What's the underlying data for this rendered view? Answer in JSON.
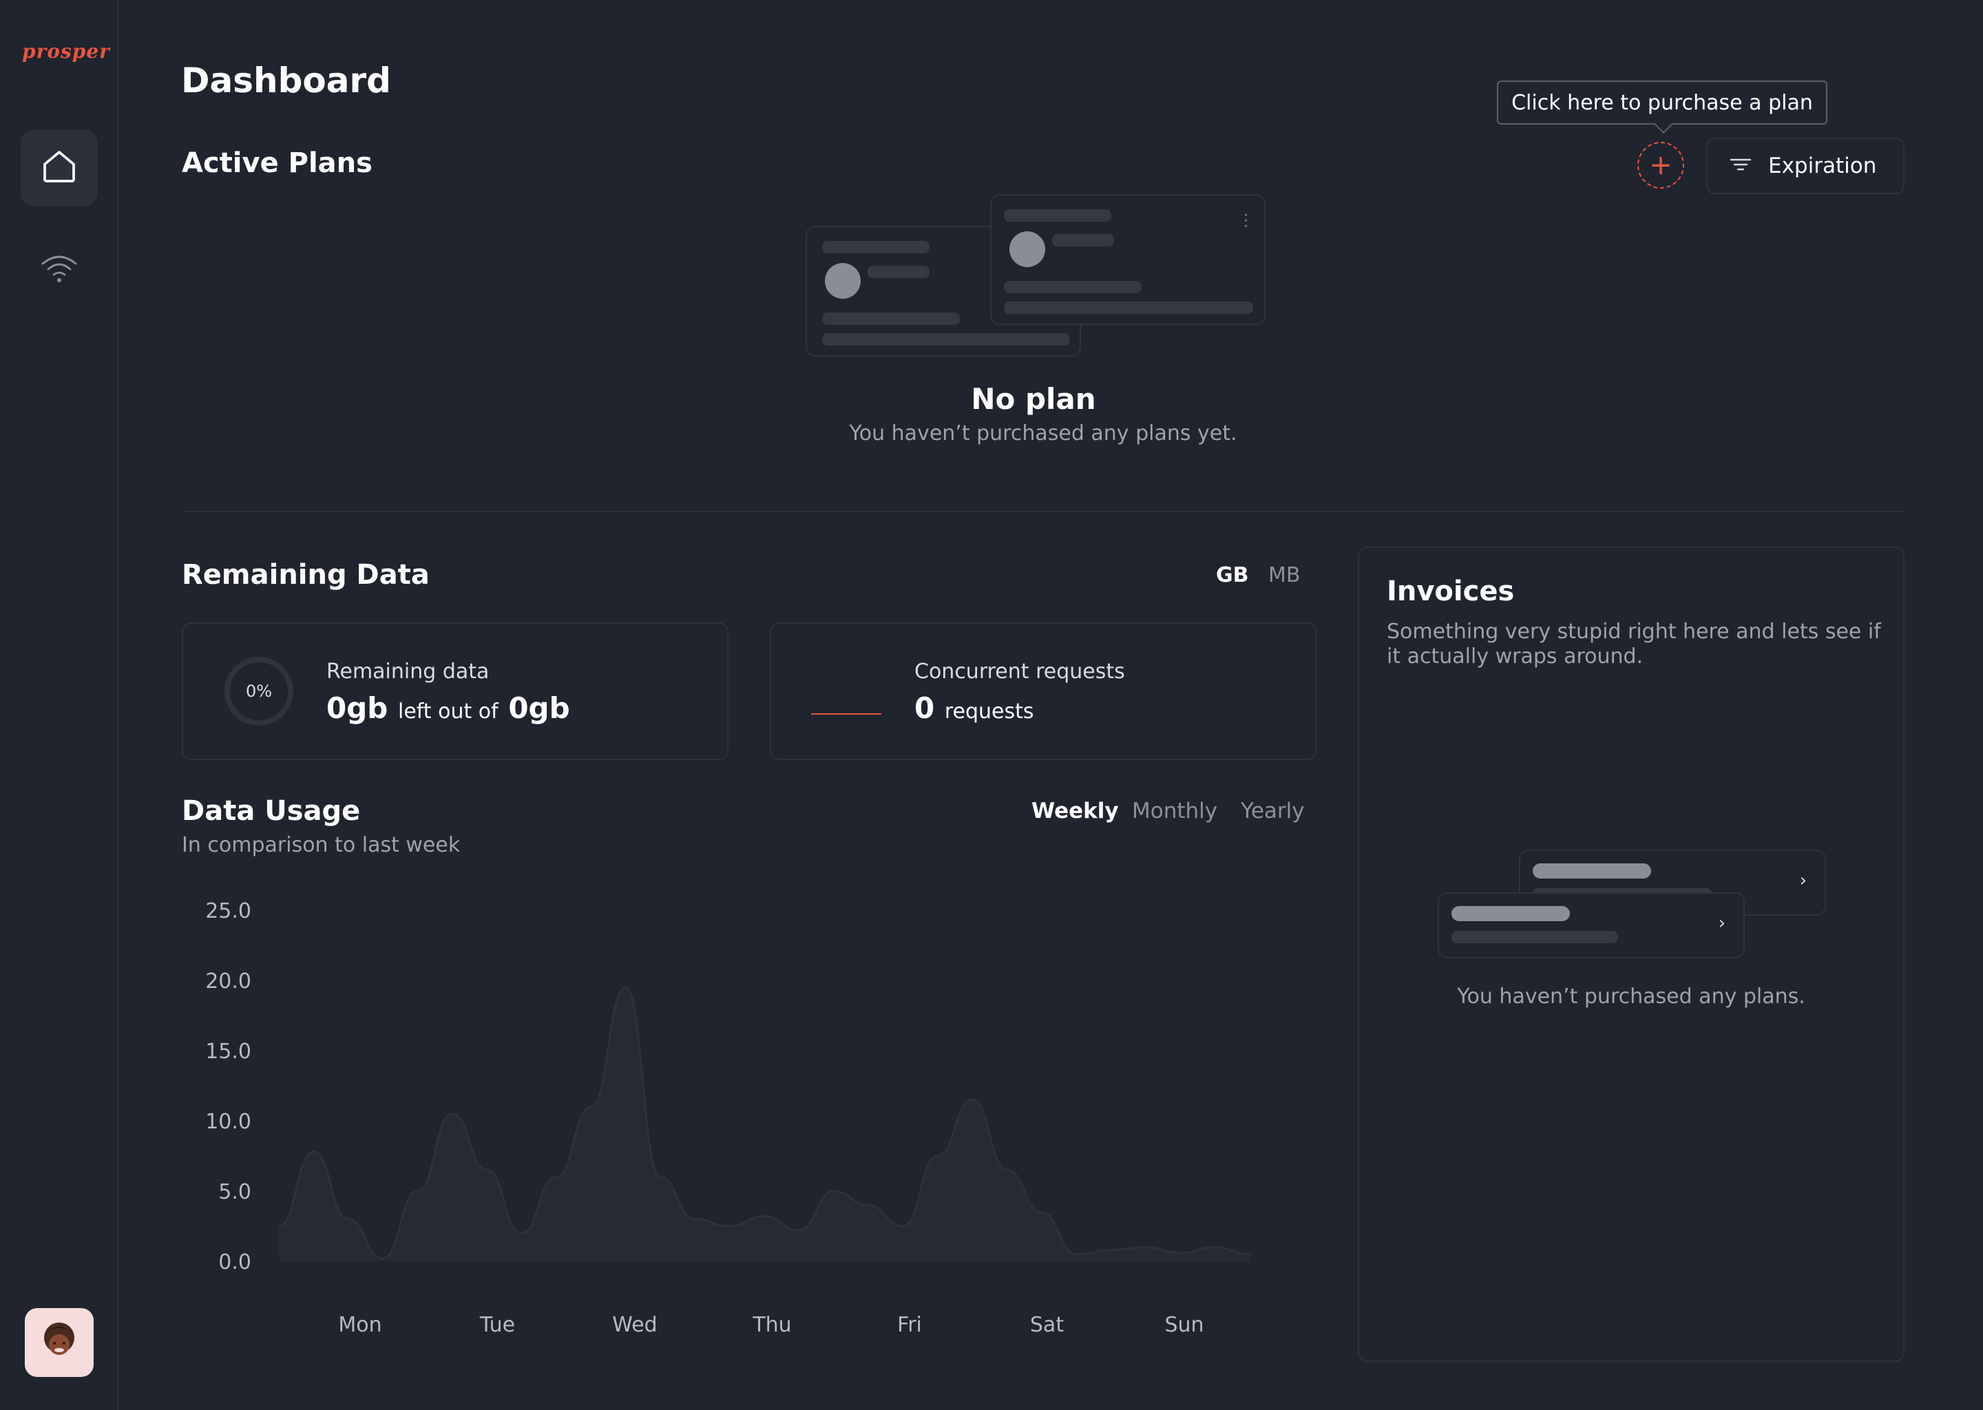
{
  "sidebar": {
    "logo": "prosper",
    "items": [
      {
        "icon": "home-icon"
      },
      {
        "icon": "wifi-icon"
      }
    ]
  },
  "header": {
    "title": "Dashboard"
  },
  "active_plans": {
    "title": "Active Plans",
    "tooltip": "Click here to purchase a plan",
    "add_icon": "plus-icon",
    "sort_label": "Expiration",
    "sort_icon": "filter-lines-icon",
    "empty_title": "No plan",
    "empty_subtitle": "You haven’t purchased any plans yet."
  },
  "remaining_data": {
    "title": "Remaining Data",
    "units": [
      "GB",
      "MB"
    ],
    "selected_unit": "GB",
    "data_card": {
      "label": "Remaining data",
      "percent": "0%",
      "value": "0gb",
      "connector": "left out of",
      "total": "0gb"
    },
    "requests_card": {
      "label": "Concurrent requests",
      "value": "0",
      "unit": "requests"
    }
  },
  "data_usage": {
    "title": "Data Usage",
    "subtitle": "In comparison to last week",
    "ranges": [
      "Weekly",
      "Monthly",
      "Yearly"
    ],
    "selected_range": "Weekly"
  },
  "invoices": {
    "title": "Invoices",
    "description": "Something very stupid right here and lets see if it actually wraps around.",
    "empty_text": "You haven’t purchased any plans."
  },
  "colors": {
    "background": "#20242e",
    "accent": "#e8553f",
    "border": "#2c313b",
    "muted_text": "#9ea2a9"
  },
  "chart_data": {
    "type": "area",
    "x": [
      "Mon",
      "Mon",
      "Mon",
      "Mon",
      "Tue",
      "Tue",
      "Tue",
      "Tue",
      "Wed",
      "Wed",
      "Wed",
      "Wed",
      "Wed",
      "Thu",
      "Thu",
      "Thu",
      "Thu",
      "Fri",
      "Fri",
      "Fri",
      "Fri",
      "Sat",
      "Sat",
      "Sat",
      "Sat",
      "Sun",
      "Sun",
      "Sun",
      "Sun"
    ],
    "categories": [
      "Mon",
      "Tue",
      "Wed",
      "Thu",
      "Fri",
      "Sat",
      "Sun"
    ],
    "y_ticks": [
      "25.0",
      "20.0",
      "15.0",
      "10.0",
      "5.0",
      "0.0"
    ],
    "ylim": [
      0,
      25
    ],
    "values": [
      2.5,
      7.8,
      3.0,
      0.2,
      5.0,
      10.5,
      6.5,
      2.0,
      6.0,
      11.0,
      19.5,
      6.0,
      3.0,
      2.5,
      3.2,
      2.2,
      5.0,
      4.0,
      2.5,
      7.5,
      11.5,
      6.5,
      3.5,
      0.5,
      0.8,
      1.0,
      0.6,
      1.0,
      0.5
    ],
    "title": "",
    "xlabel": "",
    "ylabel": "",
    "grid": false
  }
}
